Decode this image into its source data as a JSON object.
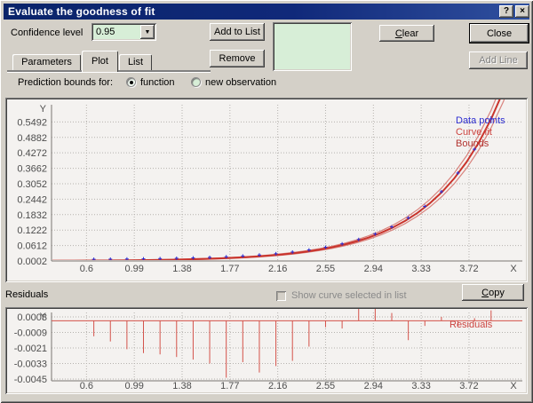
{
  "window": {
    "title": "Evaluate the goodness of fit",
    "help_button": "?",
    "close_glyph": "×"
  },
  "controls": {
    "confidence_label": "Confidence level",
    "confidence_value": "0.95",
    "add_to_list": "Add to List",
    "remove": "Remove",
    "clear": "Clear",
    "close": "Close",
    "add_line": "Add Line",
    "copy": "Copy"
  },
  "tabs": [
    {
      "label": "Parameters",
      "active": false
    },
    {
      "label": "Plot",
      "active": true
    },
    {
      "label": "List",
      "active": false
    }
  ],
  "prediction": {
    "label": "Prediction bounds for:",
    "options": [
      {
        "label": "function",
        "selected": true
      },
      {
        "label": "new observation",
        "selected": false
      }
    ]
  },
  "residuals_section": {
    "label": "Residuals",
    "checkbox_label": "Show curve selected  in list",
    "checkbox_checked": false
  },
  "colors": {
    "curve": "#c9342c",
    "bounds": "#d9837d",
    "points": "#2d2dd0",
    "residual": "#d4524a",
    "grid": "#b5b2ae",
    "axis": "#7a7772",
    "tick_text": "#4d4d4d",
    "field_green": "#d7eed7"
  },
  "chart_data": [
    {
      "type": "line",
      "title": "",
      "xlabel": "X",
      "ylabel": "Y",
      "xlim": [
        0.315,
        4.155
      ],
      "ylim": [
        0.0002,
        0.617
      ],
      "xticks": [
        0.6,
        0.99,
        1.38,
        1.77,
        2.16,
        2.55,
        2.94,
        3.33,
        3.72
      ],
      "xtick_labels": [
        "0.6",
        "0.99",
        "1.38",
        "1.77",
        "2.16",
        "2.55",
        "2.94",
        "3.33",
        "3.72"
      ],
      "yticks": [
        0.0002,
        0.0612,
        0.1222,
        0.1832,
        0.2442,
        0.3052,
        0.3662,
        0.4272,
        0.4882,
        0.5492
      ],
      "ytick_labels": [
        "0.0002",
        "0.0612",
        "0.1222",
        "0.1832",
        "0.2442",
        "0.3052",
        "0.3662",
        "0.4272",
        "0.4882",
        "0.5492"
      ],
      "grid": true,
      "legend_position": "top-right",
      "legend": [
        {
          "label": "Data points",
          "color": "#2d2dd0"
        },
        {
          "label": "Curve fit",
          "color": "#cc4440"
        },
        {
          "label": "Bounds",
          "color": "#b23430"
        }
      ],
      "series": {
        "curve_fit": {
          "x": [
            0.3,
            0.4,
            0.5,
            0.6,
            0.7,
            0.8,
            0.9,
            1.0,
            1.1,
            1.2,
            1.3,
            1.4,
            1.5,
            1.6,
            1.7,
            1.8,
            1.9,
            2.0,
            2.1,
            2.2,
            2.3,
            2.4,
            2.5,
            2.6,
            2.7,
            2.8,
            2.9,
            3.0,
            3.1,
            3.2,
            3.3,
            3.4,
            3.5,
            3.6,
            3.7,
            3.8,
            3.9,
            4.0,
            4.1
          ],
          "y": [
            0.00086,
            0.00103,
            0.00123,
            0.00147,
            0.00176,
            0.00211,
            0.00253,
            0.00302,
            0.00362,
            0.00433,
            0.00519,
            0.00621,
            0.00744,
            0.0089,
            0.01066,
            0.01276,
            0.01528,
            0.0183,
            0.02191,
            0.02623,
            0.03141,
            0.03761,
            0.04503,
            0.05392,
            0.06456,
            0.0773,
            0.09255,
            0.11081,
            0.13268,
            0.15886,
            0.1902,
            0.22773,
            0.27266,
            0.32645,
            0.39086,
            0.46798,
            0.56032,
            0.67086,
            0.8032
          ]
        },
        "bounds_spread": {
          "mul": 0.06,
          "add": 0.0012
        },
        "data_points": {
          "x": [
            0.66,
            0.795,
            0.93,
            1.065,
            1.2,
            1.335,
            1.47,
            1.605,
            1.74,
            1.875,
            2.01,
            2.145,
            2.28,
            2.415,
            2.55,
            2.685,
            2.82,
            2.955,
            3.09,
            3.225,
            3.36,
            3.495,
            3.63,
            3.765,
            3.9
          ],
          "y": [
            0.00164,
            0.00209,
            0.00266,
            0.00339,
            0.00433,
            0.00552,
            0.00703,
            0.00897,
            0.01143,
            0.01457,
            0.01858,
            0.02368,
            0.03019,
            0.03849,
            0.04906,
            0.06254,
            0.07973,
            0.10163,
            0.12956,
            0.16516,
            0.21054,
            0.26839,
            0.34214,
            0.43615,
            0.556
          ]
        }
      }
    },
    {
      "type": "stem",
      "title": "",
      "xlabel": "X",
      "ylabel": "Y",
      "xlim": [
        0.315,
        4.155
      ],
      "ylim": [
        -0.00464,
        0.00064
      ],
      "xticks": [
        0.6,
        0.99,
        1.38,
        1.77,
        2.16,
        2.55,
        2.94,
        3.33,
        3.72
      ],
      "xtick_labels": [
        "0.6",
        "0.99",
        "1.38",
        "1.77",
        "2.16",
        "2.55",
        "2.94",
        "3.33",
        "3.72"
      ],
      "yticks": [
        0.0003,
        -0.0009,
        -0.0021,
        -0.0033,
        -0.0045
      ],
      "ytick_labels": [
        "0.0003",
        "-0.0009",
        "-0.0021",
        "-0.0033",
        "-0.0045"
      ],
      "grid": true,
      "zero_line": true,
      "legend": [
        {
          "label": "Residuals",
          "color": "#cc4440"
        }
      ],
      "stems": {
        "x": [
          0.66,
          0.795,
          0.93,
          1.065,
          1.2,
          1.335,
          1.47,
          1.605,
          1.74,
          1.875,
          2.01,
          2.145,
          2.28,
          2.415,
          2.55,
          2.685,
          2.82,
          2.955,
          3.09,
          3.225,
          3.36,
          3.495,
          3.63,
          3.765,
          3.9
        ],
        "values": [
          -0.0012,
          -0.0016,
          -0.0022,
          -0.0025,
          -0.0026,
          -0.0028,
          -0.003,
          -0.0033,
          -0.0044,
          -0.0032,
          -0.004,
          -0.0035,
          -0.0031,
          -0.002,
          -0.0005,
          -0.0006,
          0.001,
          0.0013,
          0.0006,
          -0.0015,
          -0.0004,
          0.0003,
          -0.0004,
          0.0002,
          0.0008
        ]
      }
    }
  ]
}
